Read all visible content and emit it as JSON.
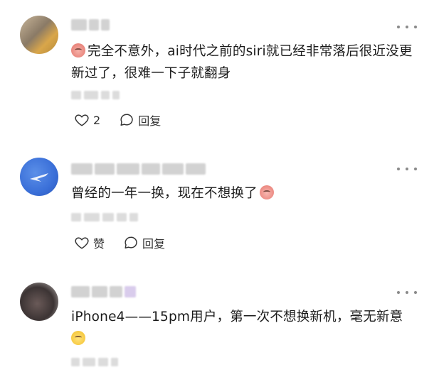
{
  "comments": [
    {
      "text": "完全不意外，ai时代之前的siri就已经非常落后很近没更新过了，很难一下子就翻身",
      "like_label": "2",
      "reply_label": "回复"
    },
    {
      "text": "曾经的一年一换，现在不想换了",
      "like_label": "赞",
      "reply_label": "回复"
    },
    {
      "text": "iPhone4——15pm用户，第一次不想换新机，毫无新意"
    }
  ],
  "colors": {
    "text": "#1a1a1a",
    "icon": "#333333",
    "more": "#8a8a8a"
  },
  "icons": [
    "heart-icon",
    "comment-bubble-icon",
    "more-dots-icon"
  ]
}
